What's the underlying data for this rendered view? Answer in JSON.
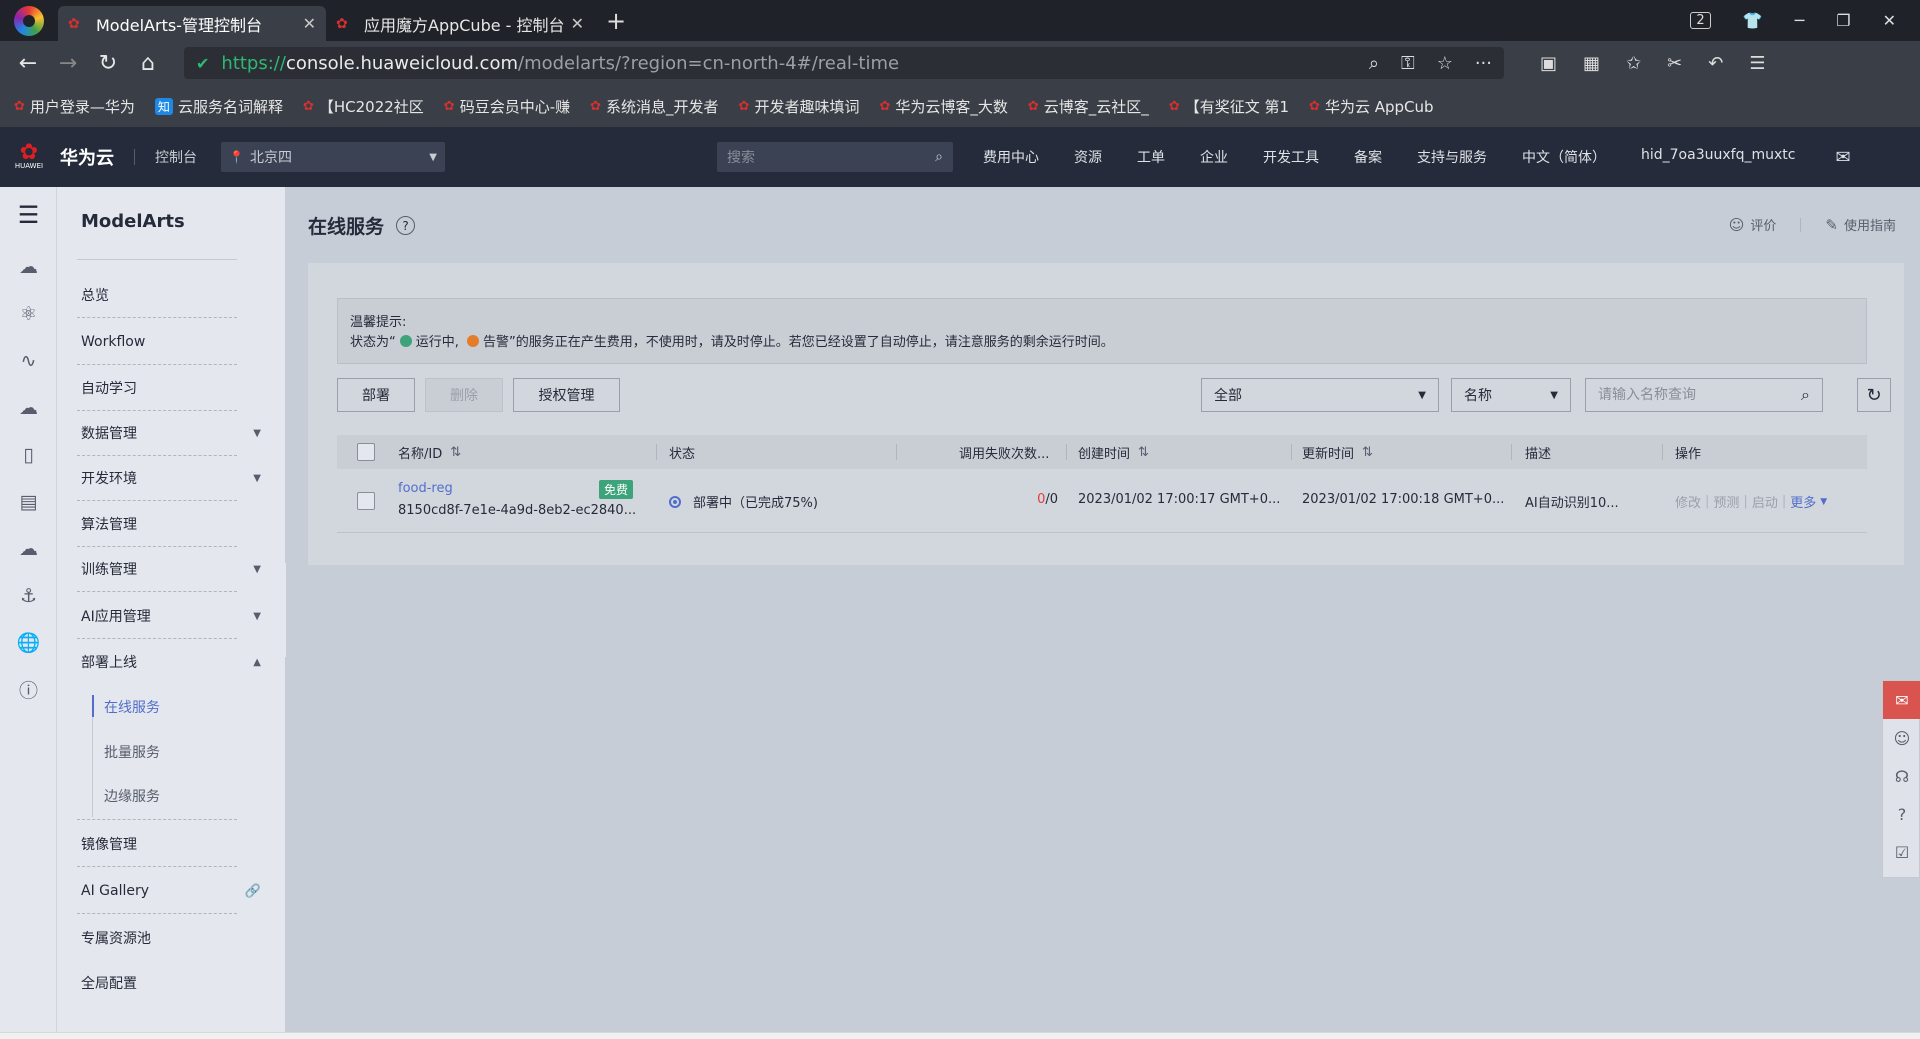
{
  "browser": {
    "tabs": [
      {
        "title": "ModelArts-管理控制台",
        "active": true
      },
      {
        "title": "应用魔方AppCube - 控制台",
        "active": false
      }
    ],
    "new_tab": "+",
    "tab_count": "2",
    "url": {
      "scheme": "https://",
      "host": "console.huaweicloud.com",
      "path": "/modelarts/?region=cn-north-4#/real-time"
    },
    "bookmarks": [
      "用户登录—华为",
      "云服务名词解释",
      "【HC2022社区",
      "码豆会员中心-赚",
      "系统消息_开发者",
      "开发者趣味填词",
      "华为云博客_大数",
      "云博客_云社区_",
      "【有奖征文 第1",
      "华为云 AppCub"
    ]
  },
  "console_header": {
    "brand": "华为云",
    "logo_text": "HUAWEI",
    "console": "控制台",
    "region": "北京四",
    "search_placeholder": "搜索",
    "nav": [
      "费用中心",
      "资源",
      "工单",
      "企业",
      "开发工具",
      "备案",
      "支持与服务",
      "中文（简体）",
      "hid_7oa3uuxfq_muxtc"
    ]
  },
  "sidebar": {
    "title": "ModelArts",
    "items": [
      {
        "label": "总览",
        "has_arrow": false
      },
      {
        "label": "Workflow",
        "has_arrow": false
      },
      {
        "label": "自动学习",
        "has_arrow": false
      },
      {
        "label": "数据管理",
        "has_arrow": true
      },
      {
        "label": "开发环境",
        "has_arrow": true
      },
      {
        "label": "算法管理",
        "has_arrow": false
      },
      {
        "label": "训练管理",
        "has_arrow": true
      },
      {
        "label": "AI应用管理",
        "has_arrow": true
      },
      {
        "label": "部署上线",
        "has_arrow": true
      },
      {
        "label": "镜像管理",
        "has_arrow": false
      },
      {
        "label": "AI Gallery",
        "has_arrow": false
      },
      {
        "label": "专属资源池",
        "has_arrow": false
      },
      {
        "label": "全局配置",
        "has_arrow": false
      }
    ],
    "deploy_sub": [
      "在线服务",
      "批量服务",
      "边缘服务"
    ]
  },
  "main": {
    "title": "在线服务",
    "rate": "评价",
    "guide": "使用指南",
    "tip": {
      "title": "温馨提示:",
      "text_prefix": "状态为“",
      "running": "运行中,",
      "warning": "告警",
      "text_suffix": "”的服务正在产生费用，不使用时，请及时停止。若您已经设置了自动停止，请注意服务的剩余运行时间。"
    },
    "buttons": {
      "deploy": "部署",
      "delete": "删除",
      "auth": "授权管理"
    },
    "filter_all": "全部",
    "filter_field": "名称",
    "search_placeholder": "请输入名称查询",
    "table": {
      "headers": [
        "名称/ID",
        "状态",
        "调用失败次数...",
        "创建时间",
        "更新时间",
        "描述",
        "操作"
      ],
      "rows": [
        {
          "name": "food-reg",
          "badge": "免费",
          "id": "8150cd8f-7e1e-4a9d-8eb2-ec2840...",
          "status": "部署中（已完成75%)",
          "fail_count": "0",
          "fail_total": "/0",
          "created": "2023/01/02 17:00:17 GMT+0...",
          "updated": "2023/01/02 17:00:18 GMT+0...",
          "desc": "AI自动识别10...",
          "ops": [
            "修改",
            "预测",
            "启动",
            "更多"
          ]
        }
      ]
    }
  }
}
